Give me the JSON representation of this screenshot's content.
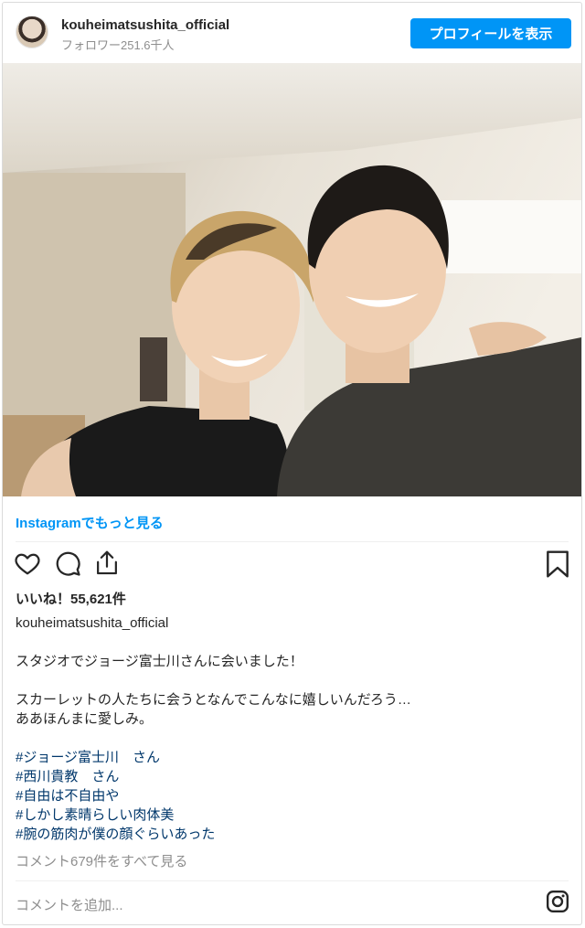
{
  "header": {
    "username": "kouheimatsushita_official",
    "followers": "フォロワー251.6千人",
    "profile_button": "プロフィールを表示"
  },
  "post": {
    "more_link": "Instagramでもっと見る",
    "likes": "いいね！55,621件",
    "caption_user": "kouheimatsushita_official",
    "caption_lines": [
      "スタジオでジョージ富士川さんに会いました！",
      "",
      "スカーレットの人たちに会うとなんでこんなに嬉しいんだろう…",
      "ああほんまに愛しみ。"
    ],
    "hashtags": [
      "#ジョージ富士川　さん",
      "#西川貴教　さん",
      "#自由は不自由や",
      "#しかし素晴らしい肉体美",
      "#腕の筋肉が僕の顔ぐらいあった"
    ],
    "view_comments": "コメント679件をすべて見る",
    "add_comment_placeholder": "コメントを追加..."
  },
  "icons": [
    "heart-icon",
    "comment-icon",
    "share-icon",
    "bookmark-icon",
    "instagram-icon"
  ],
  "colors": {
    "accent": "#0095f6",
    "hashtag": "#00376b",
    "muted": "#8e8e8e"
  }
}
